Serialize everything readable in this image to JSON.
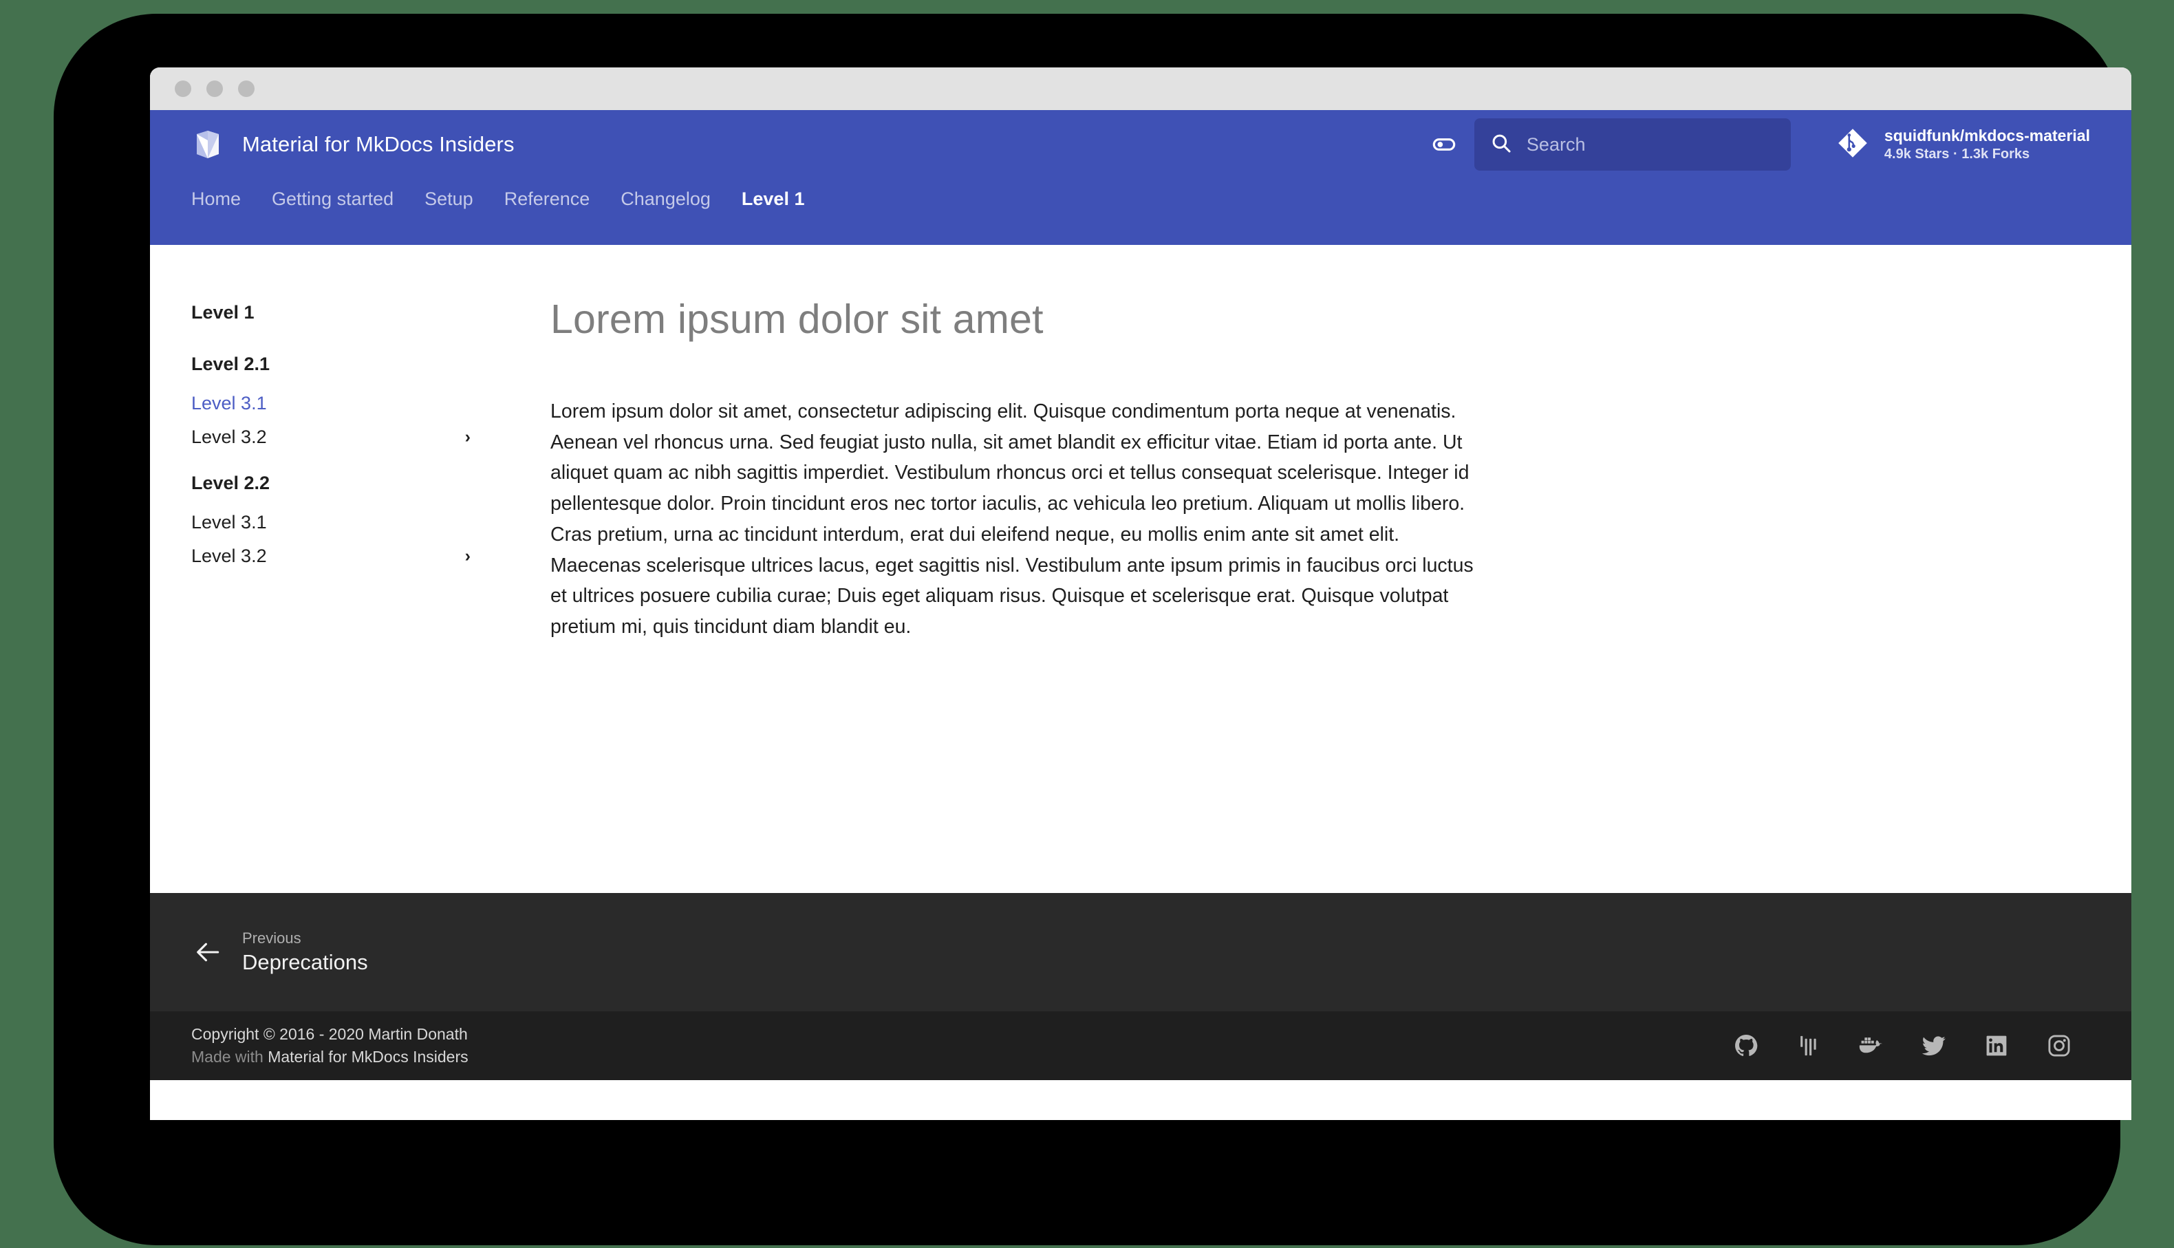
{
  "window": {
    "dots": [
      "close",
      "minimize",
      "maximize"
    ]
  },
  "header": {
    "brand_title": "Material for MkDocs Insiders",
    "logo_icon": "mkdocs-material-logo",
    "palette_toggle_icon": "toggle-switch-icon",
    "search": {
      "icon": "search-icon",
      "placeholder": "Search",
      "value": ""
    },
    "repo": {
      "icon": "git-repository-icon",
      "name": "squidfunk/mkdocs-material",
      "stats": "4.9k Stars · 1.3k Forks"
    },
    "accent_color": "#3f51b5",
    "search_bg_color": "#34419a"
  },
  "tabs": [
    {
      "label": "Home",
      "active": false
    },
    {
      "label": "Getting started",
      "active": false
    },
    {
      "label": "Setup",
      "active": false
    },
    {
      "label": "Reference",
      "active": false
    },
    {
      "label": "Changelog",
      "active": false
    },
    {
      "label": "Level 1",
      "active": true
    }
  ],
  "sidebar": {
    "items": [
      {
        "label": "Level 1",
        "type": "group-title",
        "active": false,
        "chevron": false
      },
      {
        "label": "Level 2.1",
        "type": "group-title",
        "active": false,
        "chevron": false
      },
      {
        "label": "Level 3.1",
        "type": "link",
        "active": true,
        "chevron": false
      },
      {
        "label": "Level 3.2",
        "type": "link",
        "active": false,
        "chevron": true
      },
      {
        "label": "Level 2.2",
        "type": "group-title",
        "active": false,
        "chevron": false
      },
      {
        "label": "Level 3.1",
        "type": "link",
        "active": false,
        "chevron": false
      },
      {
        "label": "Level 3.2",
        "type": "link",
        "active": false,
        "chevron": true
      }
    ],
    "chevron_glyph": "›",
    "active_color": "#4c5dc4"
  },
  "main": {
    "title": "Lorem ipsum dolor sit amet",
    "body": "Lorem ipsum dolor sit amet, consectetur adipiscing elit. Quisque condimentum porta neque at venenatis. Aenean vel rhoncus urna. Sed feugiat justo nulla, sit amet blandit ex efficitur vitae. Etiam id porta ante. Ut aliquet quam ac nibh sagittis imperdiet. Vestibulum rhoncus orci et tellus consequat scelerisque. Integer id pellentesque dolor. Proin tincidunt eros nec tortor iaculis, ac vehicula leo pretium. Aliquam ut mollis libero. Cras pretium, urna ac tincidunt interdum, erat dui eleifend neque, eu mollis enim ante sit amet elit. Maecenas scelerisque ultrices lacus, eget sagittis nisl. Vestibulum ante ipsum primis in faucibus orci luctus et ultrices posuere cubilia curae; Duis eget aliquam risus. Quisque et scelerisque erat. Quisque volutpat pretium mi, quis tincidunt diam blandit eu."
  },
  "footer_nav": {
    "previous": {
      "arrow_icon": "arrow-left-icon",
      "label": "Previous",
      "title": "Deprecations"
    }
  },
  "footer_meta": {
    "copyright": "Copyright © 2016 - 2020 Martin Donath",
    "made_with_prefix": "Made with ",
    "made_with_link": "Material for MkDocs Insiders",
    "social": [
      {
        "name": "github-icon"
      },
      {
        "name": "gitter-icon"
      },
      {
        "name": "docker-icon"
      },
      {
        "name": "twitter-icon"
      },
      {
        "name": "linkedin-icon"
      },
      {
        "name": "instagram-icon"
      }
    ]
  },
  "colors": {
    "page_bg": "#44714e",
    "frame": "#000000",
    "titlebar": "#e2e2e2",
    "footer_nav_bg": "#2a2a2a",
    "footer_meta_bg": "#1f1f1f"
  }
}
